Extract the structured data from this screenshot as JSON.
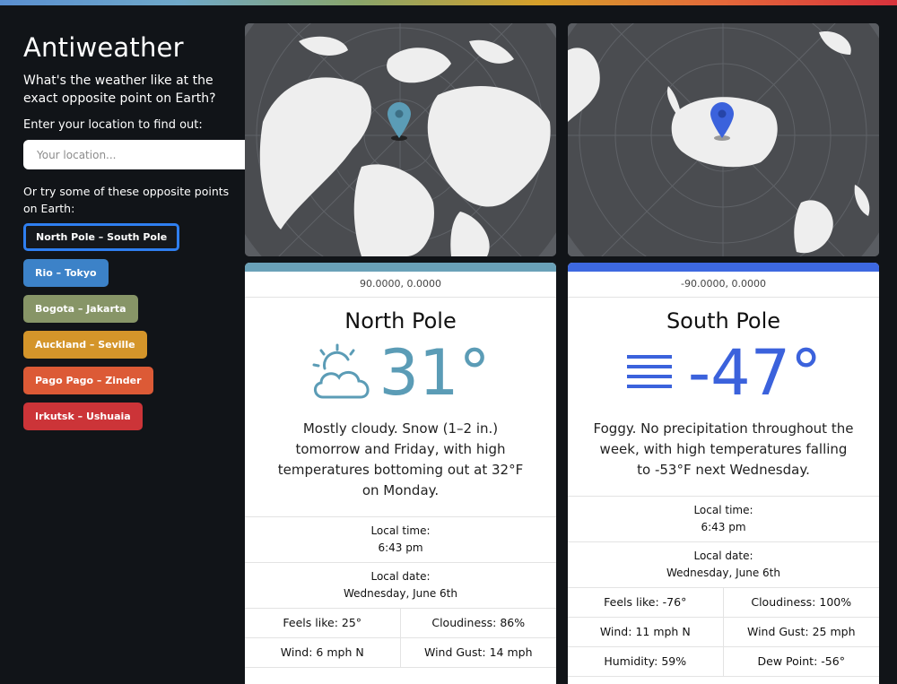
{
  "app": {
    "title": "Antiweather",
    "tagline": "What's the weather like at the exact opposite point on Earth?",
    "prompt": "Enter your location to find out:",
    "location_placeholder": "Your location...",
    "try_text": "Or try some of these opposite points on Earth:"
  },
  "pairs": [
    {
      "label": "North Pole – South Pole",
      "color": "#15181c",
      "active": true
    },
    {
      "label": "Rio – Tokyo",
      "color": "#3c82c8"
    },
    {
      "label": "Bogota – Jakarta",
      "color": "#879567"
    },
    {
      "label": "Auckland – Seville",
      "color": "#d4952a"
    },
    {
      "label": "Pago Pago – Zinder",
      "color": "#dc5a36"
    },
    {
      "label": "Irkutsk – Ushuaia",
      "color": "#cc3438"
    }
  ],
  "cards": [
    {
      "accent": "#6aa1b8",
      "coords": "90.0000, 0.0000",
      "place": "North Pole",
      "icon": "partly-cloudy-icon",
      "temp": "31°",
      "temp_color": "#5b9cb6",
      "summary": "Mostly cloudy. Snow (1–2 in.) tomorrow and Friday, with high temperatures bottoming out at 32°F on Monday.",
      "local_time_label": "Local time:",
      "local_time": "6:43 pm",
      "local_date_label": "Local date:",
      "local_date": "Wednesday, June 6th",
      "stats": [
        {
          "label": "Feels like:",
          "value": "25°"
        },
        {
          "label": "Cloudiness:",
          "value": "86%"
        },
        {
          "label": "Wind:",
          "value": "6 mph N"
        },
        {
          "label": "Wind Gust:",
          "value": "14 mph"
        }
      ]
    },
    {
      "accent": "#3d68e0",
      "coords": "-90.0000, 0.0000",
      "place": "South Pole",
      "icon": "fog-icon",
      "temp": "-47°",
      "temp_color": "#3b62dc",
      "summary": "Foggy. No precipitation throughout the week, with high temperatures falling to -53°F next Wednesday.",
      "local_time_label": "Local time:",
      "local_time": "6:43 pm",
      "local_date_label": "Local date:",
      "local_date": "Wednesday, June 6th",
      "stats": [
        {
          "label": "Feels like:",
          "value": "-76°"
        },
        {
          "label": "Cloudiness:",
          "value": "100%"
        },
        {
          "label": "Wind:",
          "value": "11 mph N"
        },
        {
          "label": "Wind Gust:",
          "value": "25 mph"
        },
        {
          "label": "Humidity:",
          "value": "59%"
        },
        {
          "label": "Dew Point:",
          "value": "-56°"
        }
      ]
    }
  ]
}
